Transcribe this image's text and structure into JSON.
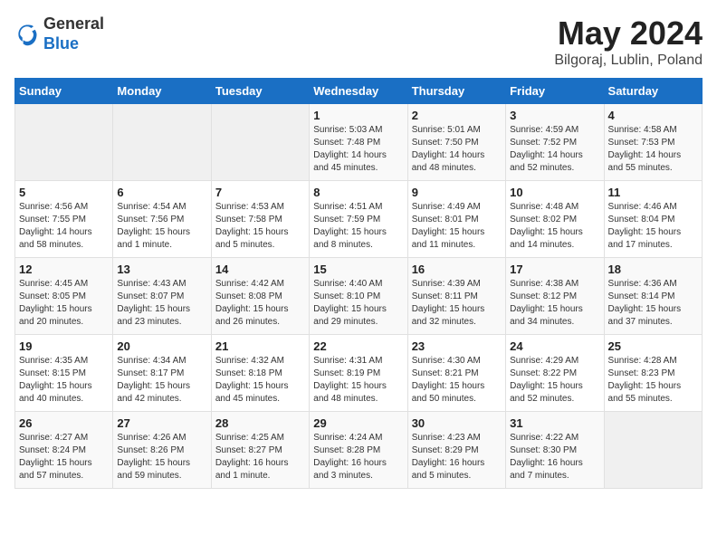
{
  "header": {
    "logo_line1": "General",
    "logo_line2": "Blue",
    "month": "May 2024",
    "location": "Bilgoraj, Lublin, Poland"
  },
  "weekdays": [
    "Sunday",
    "Monday",
    "Tuesday",
    "Wednesday",
    "Thursday",
    "Friday",
    "Saturday"
  ],
  "weeks": [
    [
      {
        "day": "",
        "info": ""
      },
      {
        "day": "",
        "info": ""
      },
      {
        "day": "",
        "info": ""
      },
      {
        "day": "1",
        "info": "Sunrise: 5:03 AM\nSunset: 7:48 PM\nDaylight: 14 hours\nand 45 minutes."
      },
      {
        "day": "2",
        "info": "Sunrise: 5:01 AM\nSunset: 7:50 PM\nDaylight: 14 hours\nand 48 minutes."
      },
      {
        "day": "3",
        "info": "Sunrise: 4:59 AM\nSunset: 7:52 PM\nDaylight: 14 hours\nand 52 minutes."
      },
      {
        "day": "4",
        "info": "Sunrise: 4:58 AM\nSunset: 7:53 PM\nDaylight: 14 hours\nand 55 minutes."
      }
    ],
    [
      {
        "day": "5",
        "info": "Sunrise: 4:56 AM\nSunset: 7:55 PM\nDaylight: 14 hours\nand 58 minutes."
      },
      {
        "day": "6",
        "info": "Sunrise: 4:54 AM\nSunset: 7:56 PM\nDaylight: 15 hours\nand 1 minute."
      },
      {
        "day": "7",
        "info": "Sunrise: 4:53 AM\nSunset: 7:58 PM\nDaylight: 15 hours\nand 5 minutes."
      },
      {
        "day": "8",
        "info": "Sunrise: 4:51 AM\nSunset: 7:59 PM\nDaylight: 15 hours\nand 8 minutes."
      },
      {
        "day": "9",
        "info": "Sunrise: 4:49 AM\nSunset: 8:01 PM\nDaylight: 15 hours\nand 11 minutes."
      },
      {
        "day": "10",
        "info": "Sunrise: 4:48 AM\nSunset: 8:02 PM\nDaylight: 15 hours\nand 14 minutes."
      },
      {
        "day": "11",
        "info": "Sunrise: 4:46 AM\nSunset: 8:04 PM\nDaylight: 15 hours\nand 17 minutes."
      }
    ],
    [
      {
        "day": "12",
        "info": "Sunrise: 4:45 AM\nSunset: 8:05 PM\nDaylight: 15 hours\nand 20 minutes."
      },
      {
        "day": "13",
        "info": "Sunrise: 4:43 AM\nSunset: 8:07 PM\nDaylight: 15 hours\nand 23 minutes."
      },
      {
        "day": "14",
        "info": "Sunrise: 4:42 AM\nSunset: 8:08 PM\nDaylight: 15 hours\nand 26 minutes."
      },
      {
        "day": "15",
        "info": "Sunrise: 4:40 AM\nSunset: 8:10 PM\nDaylight: 15 hours\nand 29 minutes."
      },
      {
        "day": "16",
        "info": "Sunrise: 4:39 AM\nSunset: 8:11 PM\nDaylight: 15 hours\nand 32 minutes."
      },
      {
        "day": "17",
        "info": "Sunrise: 4:38 AM\nSunset: 8:12 PM\nDaylight: 15 hours\nand 34 minutes."
      },
      {
        "day": "18",
        "info": "Sunrise: 4:36 AM\nSunset: 8:14 PM\nDaylight: 15 hours\nand 37 minutes."
      }
    ],
    [
      {
        "day": "19",
        "info": "Sunrise: 4:35 AM\nSunset: 8:15 PM\nDaylight: 15 hours\nand 40 minutes."
      },
      {
        "day": "20",
        "info": "Sunrise: 4:34 AM\nSunset: 8:17 PM\nDaylight: 15 hours\nand 42 minutes."
      },
      {
        "day": "21",
        "info": "Sunrise: 4:32 AM\nSunset: 8:18 PM\nDaylight: 15 hours\nand 45 minutes."
      },
      {
        "day": "22",
        "info": "Sunrise: 4:31 AM\nSunset: 8:19 PM\nDaylight: 15 hours\nand 48 minutes."
      },
      {
        "day": "23",
        "info": "Sunrise: 4:30 AM\nSunset: 8:21 PM\nDaylight: 15 hours\nand 50 minutes."
      },
      {
        "day": "24",
        "info": "Sunrise: 4:29 AM\nSunset: 8:22 PM\nDaylight: 15 hours\nand 52 minutes."
      },
      {
        "day": "25",
        "info": "Sunrise: 4:28 AM\nSunset: 8:23 PM\nDaylight: 15 hours\nand 55 minutes."
      }
    ],
    [
      {
        "day": "26",
        "info": "Sunrise: 4:27 AM\nSunset: 8:24 PM\nDaylight: 15 hours\nand 57 minutes."
      },
      {
        "day": "27",
        "info": "Sunrise: 4:26 AM\nSunset: 8:26 PM\nDaylight: 15 hours\nand 59 minutes."
      },
      {
        "day": "28",
        "info": "Sunrise: 4:25 AM\nSunset: 8:27 PM\nDaylight: 16 hours\nand 1 minute."
      },
      {
        "day": "29",
        "info": "Sunrise: 4:24 AM\nSunset: 8:28 PM\nDaylight: 16 hours\nand 3 minutes."
      },
      {
        "day": "30",
        "info": "Sunrise: 4:23 AM\nSunset: 8:29 PM\nDaylight: 16 hours\nand 5 minutes."
      },
      {
        "day": "31",
        "info": "Sunrise: 4:22 AM\nSunset: 8:30 PM\nDaylight: 16 hours\nand 7 minutes."
      },
      {
        "day": "",
        "info": ""
      }
    ]
  ]
}
